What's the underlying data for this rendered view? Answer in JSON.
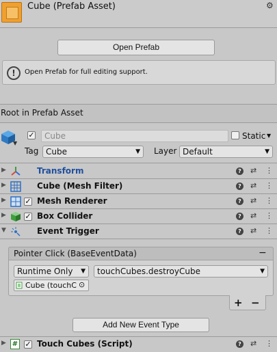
{
  "header": {
    "title": "Cube (Prefab Asset)"
  },
  "open_prefab_label": "Open Prefab",
  "help_text": "Open Prefab for full editing support.",
  "root_label": "Root in Prefab Asset",
  "gameobject": {
    "name": "Cube",
    "static_label": "Static",
    "tag_label": "Tag",
    "tag_value": "Cube",
    "layer_label": "Layer",
    "layer_value": "Default"
  },
  "components": [
    {
      "label": "Transform"
    },
    {
      "label": "Cube (Mesh Filter)"
    },
    {
      "label": "Mesh Renderer"
    },
    {
      "label": "Box Collider"
    },
    {
      "label": "Event Trigger"
    }
  ],
  "event_trigger": {
    "entry_label": "Pointer Click (BaseEventData)",
    "minus": "−",
    "runtime": "Runtime Only",
    "function": "touchCubes.destroyCube",
    "object_value": "Cube (touchC",
    "plus": "+",
    "minus2": "−",
    "add_event_label": "Add New Event Type"
  },
  "script_component": {
    "label": "Touch Cubes (Script)",
    "hash": "#"
  },
  "colors": {
    "transform_label": "#1f4f9e"
  }
}
